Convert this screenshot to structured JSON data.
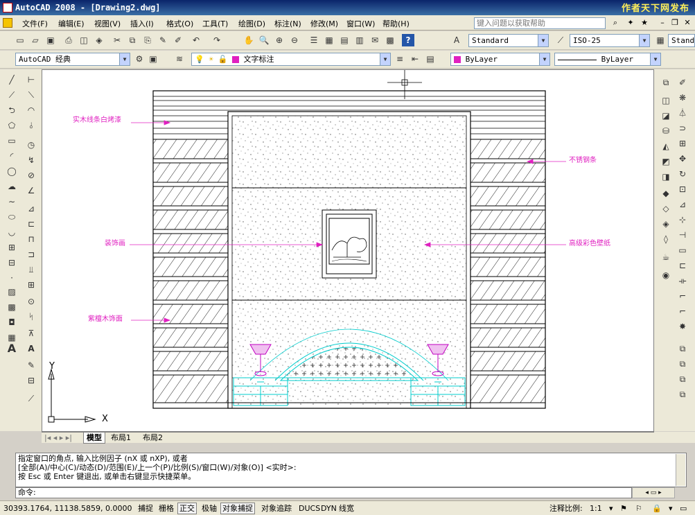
{
  "window": {
    "title": "AutoCAD 2008 - [Drawing2.dwg]",
    "brand": "作者天下网发布"
  },
  "menu": {
    "items": [
      "文件(F)",
      "编辑(E)",
      "视图(V)",
      "插入(I)",
      "格式(O)",
      "工具(T)",
      "绘图(D)",
      "标注(N)",
      "修改(M)",
      "窗口(W)",
      "帮助(H)"
    ],
    "help_placeholder": "键入问题以获取帮助"
  },
  "toolbar": {
    "text_style": "Standard",
    "dim_style": "ISO-25",
    "table_style": "Stand",
    "workspace": "AutoCAD 经典",
    "layer": "文字标注",
    "color": "ByLayer",
    "linetype": "ByLayer"
  },
  "drawing": {
    "labels": [
      "实木线条白烤漆",
      "不锈钢条",
      "装饰画",
      "高级彩色壁纸",
      "紫檀木饰面"
    ],
    "ucs_x": "X",
    "ucs_y": "Y"
  },
  "tabs": [
    "模型",
    "布局1",
    "布局2"
  ],
  "command": {
    "lines": [
      "指定窗口的角点, 输入比例因子 (nX 或 nXP), 或者",
      "[全部(A)/中心(C)/动态(D)/范围(E)/上一个(P)/比例(S)/窗口(W)/对象(O)] <实时>:",
      "按 Esc 或 Enter 键退出, 或单击右键显示快捷菜单。"
    ],
    "prompt": "命令:"
  },
  "status": {
    "coords": "30393.1764, 11138.5859, 0.0000",
    "toggles": [
      "捕捉",
      "栅格",
      "正交",
      "极轴",
      "对象捕捉",
      "对象追踪",
      "DUCS",
      "DYN",
      "线宽"
    ],
    "active": [
      2,
      4
    ],
    "annotation_scale_label": "注释比例:",
    "annotation_scale": "1:1"
  }
}
